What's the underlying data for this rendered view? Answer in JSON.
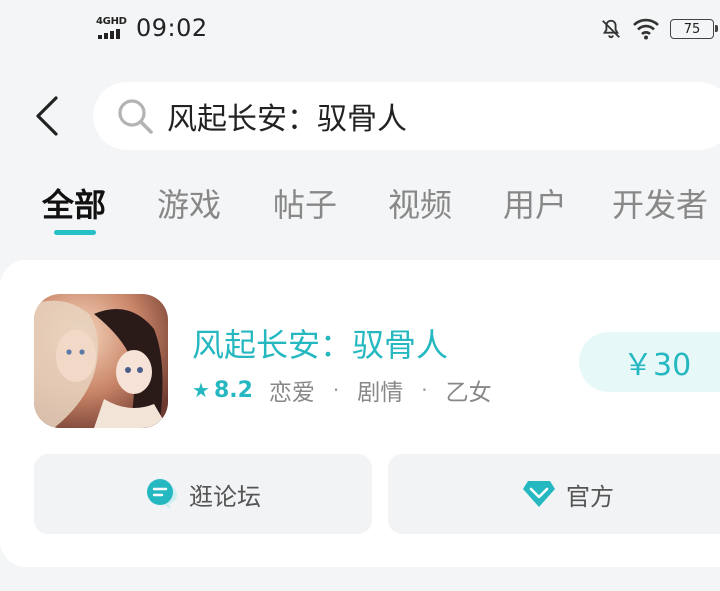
{
  "status_bar": {
    "network": "4GHD",
    "time": "09:02",
    "battery": "75"
  },
  "header": {
    "search_query": "风起长安：驭骨人"
  },
  "tabs": [
    {
      "label": "全部",
      "active": true
    },
    {
      "label": "游戏",
      "active": false
    },
    {
      "label": "帖子",
      "active": false
    },
    {
      "label": "视频",
      "active": false
    },
    {
      "label": "用户",
      "active": false
    },
    {
      "label": "开发者",
      "active": false
    }
  ],
  "result": {
    "name": "风起长安：驭骨人",
    "rating": "8.2",
    "tags": [
      "恋爱",
      "剧情",
      "乙女"
    ],
    "price": "￥30",
    "forum_label": "逛论坛",
    "official_label": "官方"
  },
  "colors": {
    "accent": "#26b8c0",
    "price_bg": "#e7f8f9"
  }
}
